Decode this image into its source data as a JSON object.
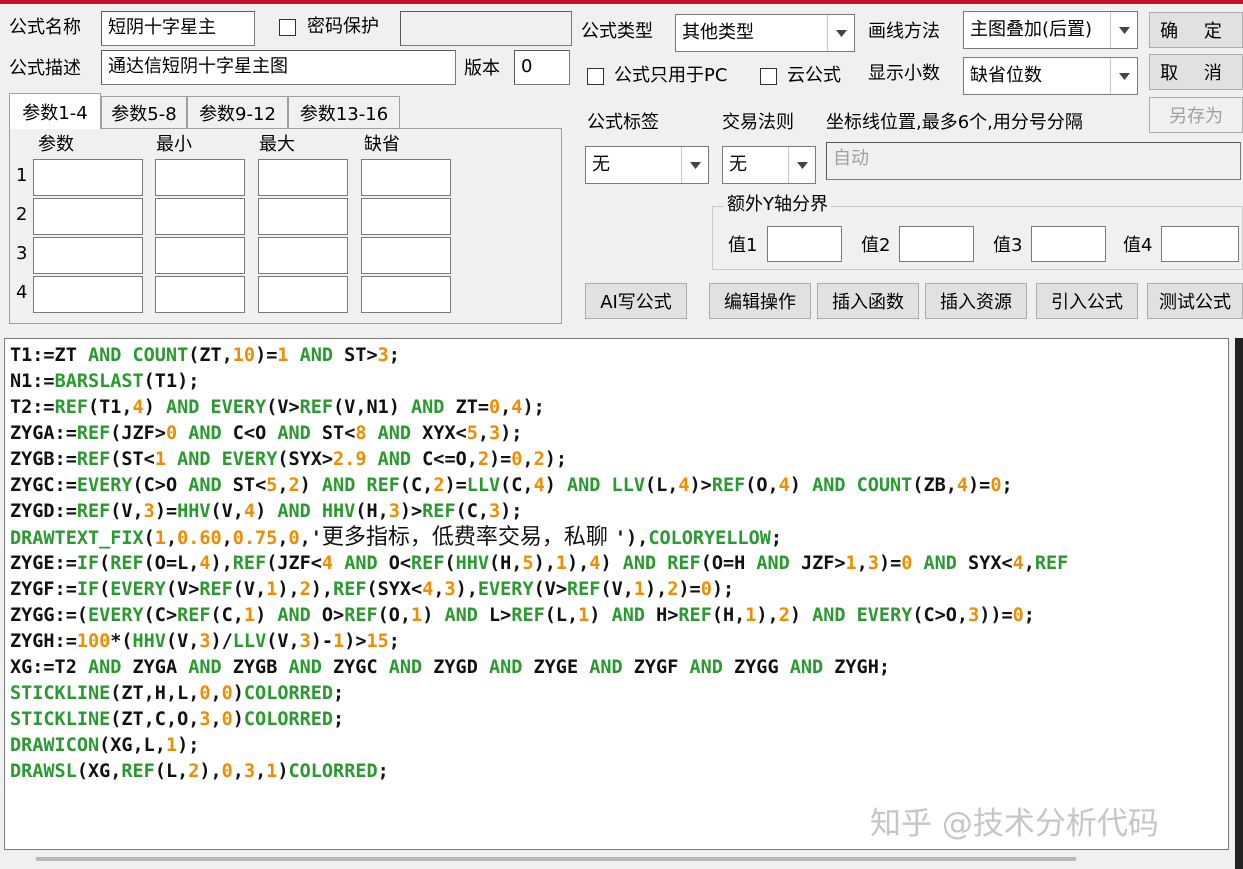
{
  "formula": {
    "name_label": "公式名称",
    "name_value": "短阴十字星主",
    "password_protect_label": "密码保护",
    "password_value": "",
    "desc_label": "公式描述",
    "desc_value": "通达信短阴十字星主图",
    "version_label": "版本",
    "version_value": "0"
  },
  "param_tabs": [
    "参数1-4",
    "参数5-8",
    "参数9-12",
    "参数13-16"
  ],
  "param_table": {
    "headers": [
      "参数",
      "最小",
      "最大",
      "缺省"
    ],
    "rows": [
      "1",
      "2",
      "3",
      "4"
    ]
  },
  "settings": {
    "type_label": "公式类型",
    "type_value": "其他类型",
    "draw_label": "画线方法",
    "draw_value": "主图叠加(后置)",
    "pc_only_label": "公式只用于PC",
    "cloud_label": "云公式",
    "decimals_label": "显示小数",
    "decimals_value": "缺省位数",
    "tag_label": "公式标签",
    "tag_value": "无",
    "trade_label": "交易法则",
    "trade_value": "无",
    "coord_label": "坐标线位置,最多6个,用分号分隔",
    "coord_value": "自动",
    "yaxis_group_label": "额外Y轴分界",
    "yaxis_value_labels": [
      "值1",
      "值2",
      "值3",
      "值4"
    ]
  },
  "buttons": {
    "ok": "确 定",
    "cancel": "取 消",
    "save_as": "另存为",
    "ai": "AI写公式",
    "edit": "编辑操作",
    "insert_func": "插入函数",
    "insert_res": "插入资源",
    "import": "引入公式",
    "test": "测试公式"
  },
  "code_lines": [
    [
      [
        "n",
        "T1:=ZT "
      ],
      [
        "k",
        "AND COUNT"
      ],
      [
        "n",
        "(ZT,"
      ],
      [
        "o",
        "10"
      ],
      [
        "n",
        ")="
      ],
      [
        "o",
        "1"
      ],
      [
        "n",
        " "
      ],
      [
        "k",
        "AND"
      ],
      [
        "n",
        " ST>"
      ],
      [
        "o",
        "3"
      ],
      [
        "n",
        ";"
      ]
    ],
    [
      [
        "n",
        "N1:="
      ],
      [
        "k",
        "BARSLAST"
      ],
      [
        "n",
        "(T1);"
      ]
    ],
    [
      [
        "n",
        "T2:="
      ],
      [
        "k",
        "REF"
      ],
      [
        "n",
        "(T1,"
      ],
      [
        "o",
        "4"
      ],
      [
        "n",
        ") "
      ],
      [
        "k",
        "AND EVERY"
      ],
      [
        "n",
        "(V>"
      ],
      [
        "k",
        "REF"
      ],
      [
        "n",
        "(V,N1) "
      ],
      [
        "k",
        "AND"
      ],
      [
        "n",
        " ZT="
      ],
      [
        "o",
        "0"
      ],
      [
        "n",
        ","
      ],
      [
        "o",
        "4"
      ],
      [
        "n",
        ");"
      ]
    ],
    [
      [
        "n",
        "ZYGA:="
      ],
      [
        "k",
        "REF"
      ],
      [
        "n",
        "(JZF>"
      ],
      [
        "o",
        "0"
      ],
      [
        "n",
        " "
      ],
      [
        "k",
        "AND"
      ],
      [
        "n",
        " C<O "
      ],
      [
        "k",
        "AND"
      ],
      [
        "n",
        " ST<"
      ],
      [
        "o",
        "8"
      ],
      [
        "n",
        " "
      ],
      [
        "k",
        "AND"
      ],
      [
        "n",
        " XYX<"
      ],
      [
        "o",
        "5"
      ],
      [
        "n",
        ","
      ],
      [
        "o",
        "3"
      ],
      [
        "n",
        ");"
      ]
    ],
    [
      [
        "n",
        "ZYGB:="
      ],
      [
        "k",
        "REF"
      ],
      [
        "n",
        "(ST<"
      ],
      [
        "o",
        "1"
      ],
      [
        "n",
        " "
      ],
      [
        "k",
        "AND EVERY"
      ],
      [
        "n",
        "(SYX>"
      ],
      [
        "o",
        "2.9"
      ],
      [
        "n",
        " "
      ],
      [
        "k",
        "AND"
      ],
      [
        "n",
        " C<=O,"
      ],
      [
        "o",
        "2"
      ],
      [
        "n",
        ")="
      ],
      [
        "o",
        "0"
      ],
      [
        "n",
        ","
      ],
      [
        "o",
        "2"
      ],
      [
        "n",
        ");"
      ]
    ],
    [
      [
        "n",
        "ZYGC:="
      ],
      [
        "k",
        "EVERY"
      ],
      [
        "n",
        "(C>O "
      ],
      [
        "k",
        "AND"
      ],
      [
        "n",
        " ST<"
      ],
      [
        "o",
        "5"
      ],
      [
        "n",
        ","
      ],
      [
        "o",
        "2"
      ],
      [
        "n",
        ") "
      ],
      [
        "k",
        "AND REF"
      ],
      [
        "n",
        "(C,"
      ],
      [
        "o",
        "2"
      ],
      [
        "n",
        ")="
      ],
      [
        "k",
        "LLV"
      ],
      [
        "n",
        "(C,"
      ],
      [
        "o",
        "4"
      ],
      [
        "n",
        ") "
      ],
      [
        "k",
        "AND LLV"
      ],
      [
        "n",
        "(L,"
      ],
      [
        "o",
        "4"
      ],
      [
        "n",
        ")>"
      ],
      [
        "k",
        "REF"
      ],
      [
        "n",
        "(O,"
      ],
      [
        "o",
        "4"
      ],
      [
        "n",
        ") "
      ],
      [
        "k",
        "AND COUNT"
      ],
      [
        "n",
        "(ZB,"
      ],
      [
        "o",
        "4"
      ],
      [
        "n",
        ")="
      ],
      [
        "o",
        "0"
      ],
      [
        "n",
        ";"
      ]
    ],
    [
      [
        "n",
        "ZYGD:="
      ],
      [
        "k",
        "REF"
      ],
      [
        "n",
        "(V,"
      ],
      [
        "o",
        "3"
      ],
      [
        "n",
        ")="
      ],
      [
        "k",
        "HHV"
      ],
      [
        "n",
        "(V,"
      ],
      [
        "o",
        "4"
      ],
      [
        "n",
        ") "
      ],
      [
        "k",
        "AND HHV"
      ],
      [
        "n",
        "(H,"
      ],
      [
        "o",
        "3"
      ],
      [
        "n",
        ")>"
      ],
      [
        "k",
        "REF"
      ],
      [
        "n",
        "(C,"
      ],
      [
        "o",
        "3"
      ],
      [
        "n",
        ");"
      ]
    ],
    [
      [
        "k",
        "DRAWTEXT_FIX"
      ],
      [
        "n",
        "("
      ],
      [
        "o",
        "1"
      ],
      [
        "n",
        ","
      ],
      [
        "o",
        "0.60"
      ],
      [
        "n",
        ","
      ],
      [
        "o",
        "0.75"
      ],
      [
        "n",
        ","
      ],
      [
        "o",
        "0"
      ],
      [
        "n",
        ",'"
      ],
      [
        "z",
        "更多指标，低费率交易，私聊 "
      ],
      [
        "n",
        "'),"
      ],
      [
        "k",
        "COLORYELLOW"
      ],
      [
        "n",
        ";"
      ]
    ],
    [
      [
        "n",
        "ZYGE:="
      ],
      [
        "k",
        "IF"
      ],
      [
        "n",
        "("
      ],
      [
        "k",
        "REF"
      ],
      [
        "n",
        "(O=L,"
      ],
      [
        "o",
        "4"
      ],
      [
        "n",
        "),"
      ],
      [
        "k",
        "REF"
      ],
      [
        "n",
        "(JZF<"
      ],
      [
        "o",
        "4"
      ],
      [
        "n",
        " "
      ],
      [
        "k",
        "AND"
      ],
      [
        "n",
        " O<"
      ],
      [
        "k",
        "REF"
      ],
      [
        "n",
        "("
      ],
      [
        "k",
        "HHV"
      ],
      [
        "n",
        "(H,"
      ],
      [
        "o",
        "5"
      ],
      [
        "n",
        "),"
      ],
      [
        "o",
        "1"
      ],
      [
        "n"
      ],
      [
        "n",
        "),"
      ],
      [
        "o",
        "4"
      ],
      [
        "n",
        ") "
      ],
      [
        "k",
        "AND REF"
      ],
      [
        "n",
        "(O=H "
      ],
      [
        "k",
        "AND"
      ],
      [
        "n",
        " JZF>"
      ],
      [
        "o",
        "1"
      ],
      [
        "n",
        ","
      ],
      [
        "o",
        "3"
      ],
      [
        "n",
        ")="
      ],
      [
        "o",
        "0"
      ],
      [
        "n",
        " "
      ],
      [
        "k",
        "AND"
      ],
      [
        "n",
        " SYX<"
      ],
      [
        "o",
        "4"
      ],
      [
        "n",
        ","
      ],
      [
        "k",
        "REF"
      ]
    ],
    [
      [
        "n",
        "ZYGF:="
      ],
      [
        "k",
        "IF"
      ],
      [
        "n",
        "("
      ],
      [
        "k",
        "EVERY"
      ],
      [
        "n",
        "(V>"
      ],
      [
        "k",
        "REF"
      ],
      [
        "n",
        "(V,"
      ],
      [
        "o",
        "1"
      ],
      [
        "n",
        "),"
      ],
      [
        "o",
        "2"
      ],
      [
        "n",
        "),"
      ],
      [
        "k",
        "REF"
      ],
      [
        "n",
        "(SYX<"
      ],
      [
        "o",
        "4"
      ],
      [
        "n",
        ","
      ],
      [
        "o",
        "3"
      ],
      [
        "n",
        "),"
      ],
      [
        "k",
        "EVERY"
      ],
      [
        "n",
        "(V>"
      ],
      [
        "k",
        "REF"
      ],
      [
        "n",
        "(V,"
      ],
      [
        "o",
        "1"
      ],
      [
        "n",
        "),"
      ],
      [
        "o",
        "2"
      ],
      [
        "n",
        ")="
      ],
      [
        "o",
        "0"
      ],
      [
        "n",
        ");"
      ]
    ],
    [
      [
        "n",
        "ZYGG:=("
      ],
      [
        "k",
        "EVERY"
      ],
      [
        "n",
        "(C>"
      ],
      [
        "k",
        "REF"
      ],
      [
        "n",
        "(C,"
      ],
      [
        "o",
        "1"
      ],
      [
        "n",
        ") "
      ],
      [
        "k",
        "AND"
      ],
      [
        "n",
        " O>"
      ],
      [
        "k",
        "REF"
      ],
      [
        "n",
        "(O,"
      ],
      [
        "o",
        "1"
      ],
      [
        "n",
        ") "
      ],
      [
        "k",
        "AND"
      ],
      [
        "n",
        " L>"
      ],
      [
        "k",
        "REF"
      ],
      [
        "n",
        "(L,"
      ],
      [
        "o",
        "1"
      ],
      [
        "n",
        ") "
      ],
      [
        "k",
        "AND"
      ],
      [
        "n",
        " H>"
      ],
      [
        "k",
        "REF"
      ],
      [
        "n",
        "(H,"
      ],
      [
        "o",
        "1"
      ],
      [
        "n",
        "),"
      ],
      [
        "o",
        "2"
      ],
      [
        "n",
        ") "
      ],
      [
        "k",
        "AND EVERY"
      ],
      [
        "n",
        "(C>O,"
      ],
      [
        "o",
        "3"
      ],
      [
        "n",
        "))="
      ],
      [
        "o",
        "0"
      ],
      [
        "n",
        ";"
      ]
    ],
    [
      [
        "n",
        "ZYGH:="
      ],
      [
        "o",
        "100"
      ],
      [
        "n",
        "*("
      ],
      [
        "k",
        "HHV"
      ],
      [
        "n",
        "(V,"
      ],
      [
        "o",
        "3"
      ],
      [
        "n",
        ")/"
      ],
      [
        "k",
        "LLV"
      ],
      [
        "n",
        "(V,"
      ],
      [
        "o",
        "3"
      ],
      [
        "n",
        ")-"
      ],
      [
        "o",
        "1"
      ],
      [
        "n",
        ")>"
      ],
      [
        "o",
        "15"
      ],
      [
        "n",
        ";"
      ]
    ],
    [
      [
        "n",
        "XG:=T2 "
      ],
      [
        "k",
        "AND"
      ],
      [
        "n",
        " ZYGA "
      ],
      [
        "k",
        "AND"
      ],
      [
        "n",
        " ZYGB "
      ],
      [
        "k",
        "AND"
      ],
      [
        "n",
        " ZYGC "
      ],
      [
        "k",
        "AND"
      ],
      [
        "n",
        " ZYGD "
      ],
      [
        "k",
        "AND"
      ],
      [
        "n",
        " ZYGE "
      ],
      [
        "k",
        "AND"
      ],
      [
        "n",
        " ZYGF "
      ],
      [
        "k",
        "AND"
      ],
      [
        "n",
        " ZYGG "
      ],
      [
        "k",
        "AND"
      ],
      [
        "n",
        " ZYGH;"
      ]
    ],
    [
      [
        "k",
        "STICKLINE"
      ],
      [
        "n",
        "(ZT,H,L,"
      ],
      [
        "o",
        "0"
      ],
      [
        "n",
        ","
      ],
      [
        "o",
        "0"
      ],
      [
        "n",
        ")"
      ],
      [
        "k",
        "COLORRED"
      ],
      [
        "n",
        ";"
      ]
    ],
    [
      [
        "k",
        "STICKLINE"
      ],
      [
        "n",
        "(ZT,C,O,"
      ],
      [
        "o",
        "3"
      ],
      [
        "n",
        ","
      ],
      [
        "o",
        "0"
      ],
      [
        "n",
        ")"
      ],
      [
        "k",
        "COLORRED"
      ],
      [
        "n",
        ";"
      ]
    ],
    [
      [
        "k",
        "DRAWICON"
      ],
      [
        "n",
        "(XG,L,"
      ],
      [
        "o",
        "1"
      ],
      [
        "n",
        ");"
      ]
    ],
    [
      [
        "k",
        "DRAWSL"
      ],
      [
        "n",
        "(XG,"
      ],
      [
        "k",
        "REF"
      ],
      [
        "n",
        "(L,"
      ],
      [
        "o",
        "2"
      ],
      [
        "n",
        "),"
      ],
      [
        "o",
        "0"
      ],
      [
        "n",
        ","
      ],
      [
        "o",
        "3"
      ],
      [
        "n",
        ","
      ],
      [
        "o",
        "1"
      ],
      [
        "n",
        ")"
      ],
      [
        "k",
        "COLORRED"
      ],
      [
        "n",
        ";"
      ]
    ]
  ],
  "watermark": "知乎 @技术分析代码",
  "colors": {
    "keyword": "#2a9a30",
    "number": "#f08c00",
    "text": "#111111",
    "title_bar": "#c8102e"
  },
  "icons": [
    "dropdown-arrow-icon",
    "checkbox-icon"
  ]
}
